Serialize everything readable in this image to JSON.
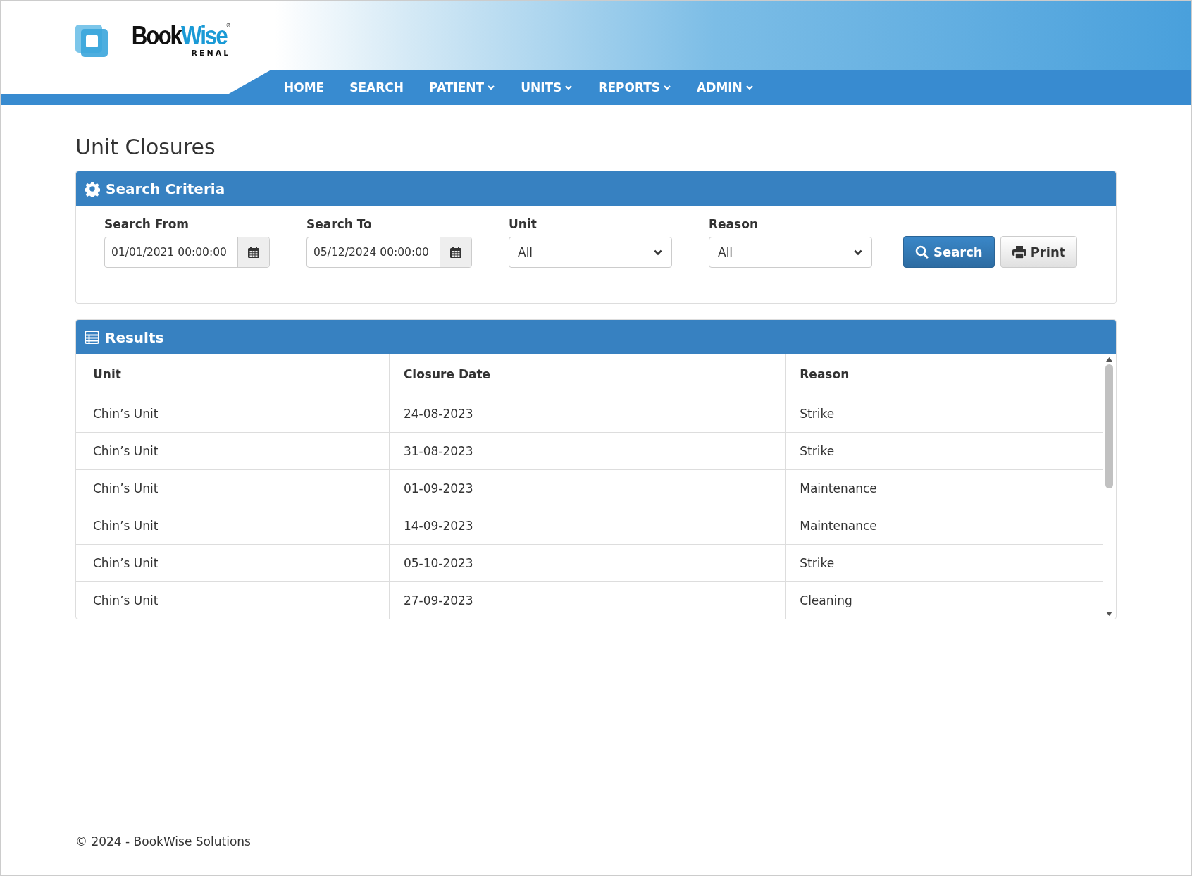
{
  "logo": {
    "name": "BookWise",
    "subtitle": "RENAL",
    "mark": "®"
  },
  "nav": [
    {
      "label": "HOME",
      "dropdown": false
    },
    {
      "label": "SEARCH",
      "dropdown": false
    },
    {
      "label": "PATIENT",
      "dropdown": true
    },
    {
      "label": "UNITS",
      "dropdown": true
    },
    {
      "label": "REPORTS",
      "dropdown": true
    },
    {
      "label": "ADMIN",
      "dropdown": true
    }
  ],
  "page_title": "Unit Closures",
  "search_panel": {
    "title": "Search Criteria",
    "fields": [
      {
        "kind": "date",
        "label": "Search From",
        "value": "01/01/2021 00:00:00"
      },
      {
        "kind": "date",
        "label": "Search To",
        "value": "05/12/2024 00:00:00"
      },
      {
        "kind": "select",
        "label": "Unit",
        "value": "All"
      },
      {
        "kind": "select",
        "label": "Reason",
        "value": "All"
      }
    ],
    "buttons": [
      {
        "kind": "primary",
        "label": "Search"
      },
      {
        "kind": "print",
        "label": "Print"
      }
    ]
  },
  "results_panel": {
    "title": "Results",
    "columns": [
      "Unit",
      "Closure Date",
      "Reason"
    ],
    "rows": [
      [
        "Chin’s Unit",
        "24-08-2023",
        "Strike"
      ],
      [
        "Chin’s Unit",
        "31-08-2023",
        "Strike"
      ],
      [
        "Chin’s Unit",
        "01-09-2023",
        "Maintenance"
      ],
      [
        "Chin’s Unit",
        "14-09-2023",
        "Maintenance"
      ],
      [
        "Chin’s Unit",
        "05-10-2023",
        "Strike"
      ],
      [
        "Chin’s Unit",
        "27-09-2023",
        "Cleaning"
      ]
    ]
  },
  "footer": "© 2024  - BookWise Solutions"
}
